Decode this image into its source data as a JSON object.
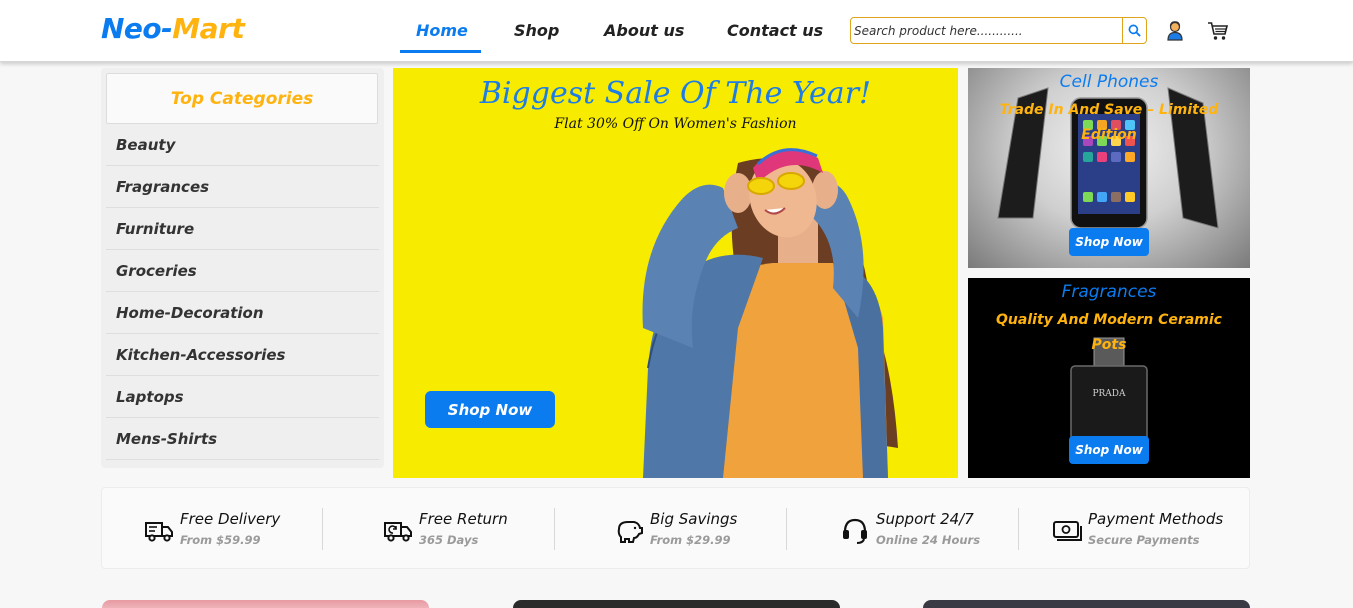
{
  "brand": {
    "part1": "Neo-",
    "part2": "Mart"
  },
  "nav": {
    "links": [
      {
        "label": "Home"
      },
      {
        "label": "Shop"
      },
      {
        "label": "About us"
      },
      {
        "label": "Contact us"
      }
    ],
    "search_placeholder": "Search product here............",
    "icons": [
      "search-icon",
      "user-icon",
      "cart-icon"
    ]
  },
  "sidebar": {
    "title": "Top Categories",
    "items": [
      {
        "label": "Beauty"
      },
      {
        "label": "Fragrances"
      },
      {
        "label": "Furniture"
      },
      {
        "label": "Groceries"
      },
      {
        "label": "Home-Decoration"
      },
      {
        "label": "Kitchen-Accessories"
      },
      {
        "label": "Laptops"
      },
      {
        "label": "Mens-Shirts"
      }
    ]
  },
  "hero": {
    "title": "Biggest Sale Of The Year!",
    "subtitle": "Flat 30% Off On Women's Fashion",
    "button": "Shop Now"
  },
  "promos": [
    {
      "title": "Cell Phones",
      "subtitle": "Trade In And Save – Limited Edition",
      "button": "Shop Now"
    },
    {
      "title": "Fragrances",
      "subtitle": "Quality And Modern Ceramic Pots",
      "button": "Shop Now"
    }
  ],
  "features": [
    {
      "title": "Free Delivery",
      "sub": "From $59.99",
      "icon": "truck-icon"
    },
    {
      "title": "Free Return",
      "sub": "365 Days",
      "icon": "return-truck-icon"
    },
    {
      "title": "Big Savings",
      "sub": "From $29.99",
      "icon": "piggy-bank-icon"
    },
    {
      "title": "Support 24/7",
      "sub": "Online 24 Hours",
      "icon": "headset-icon"
    },
    {
      "title": "Payment Methods",
      "sub": "Secure Payments",
      "icon": "cash-icon"
    }
  ],
  "colors": {
    "primary": "#0b7cf0",
    "accent": "#ffb30f",
    "hero_bg": "#f7ec00"
  }
}
